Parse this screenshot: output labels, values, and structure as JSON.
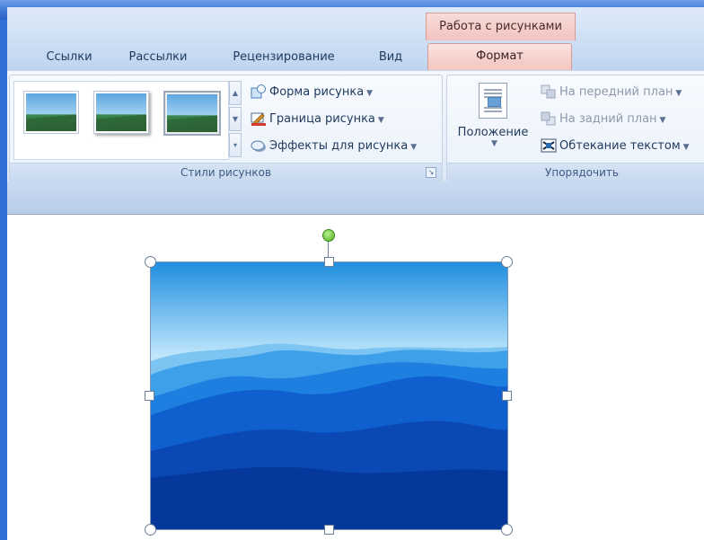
{
  "context_tab_group": "Работа с рисунками",
  "tabs": [
    {
      "label": "Ссылки"
    },
    {
      "label": "Рассылки"
    },
    {
      "label": "Рецензирование"
    },
    {
      "label": "Вид"
    }
  ],
  "active_tab": "Формат",
  "groups": {
    "picture_styles": {
      "label": "Стили рисунков",
      "commands": {
        "shape": "Форма рисунка",
        "border": "Граница рисунка",
        "effects": "Эффекты для рисунка"
      }
    },
    "arrange": {
      "label": "Упорядочить",
      "position": "Положение",
      "bring_front": "На передний план",
      "send_back": "На задний план",
      "wrap_text": "Обтекание текстом"
    }
  },
  "colors": {
    "frame_blue": "#2f6fd6",
    "context_tab": "#f3c6c0",
    "ribbon_bg": "#e7eff9",
    "rotate_handle": "#49b023"
  },
  "icons": {
    "shape": "picture-shape-icon",
    "border": "picture-border-icon",
    "effects": "picture-effects-icon",
    "bring_front": "bring-forward-icon",
    "send_back": "send-backward-icon",
    "wrap": "text-wrap-icon",
    "position": "position-icon"
  }
}
